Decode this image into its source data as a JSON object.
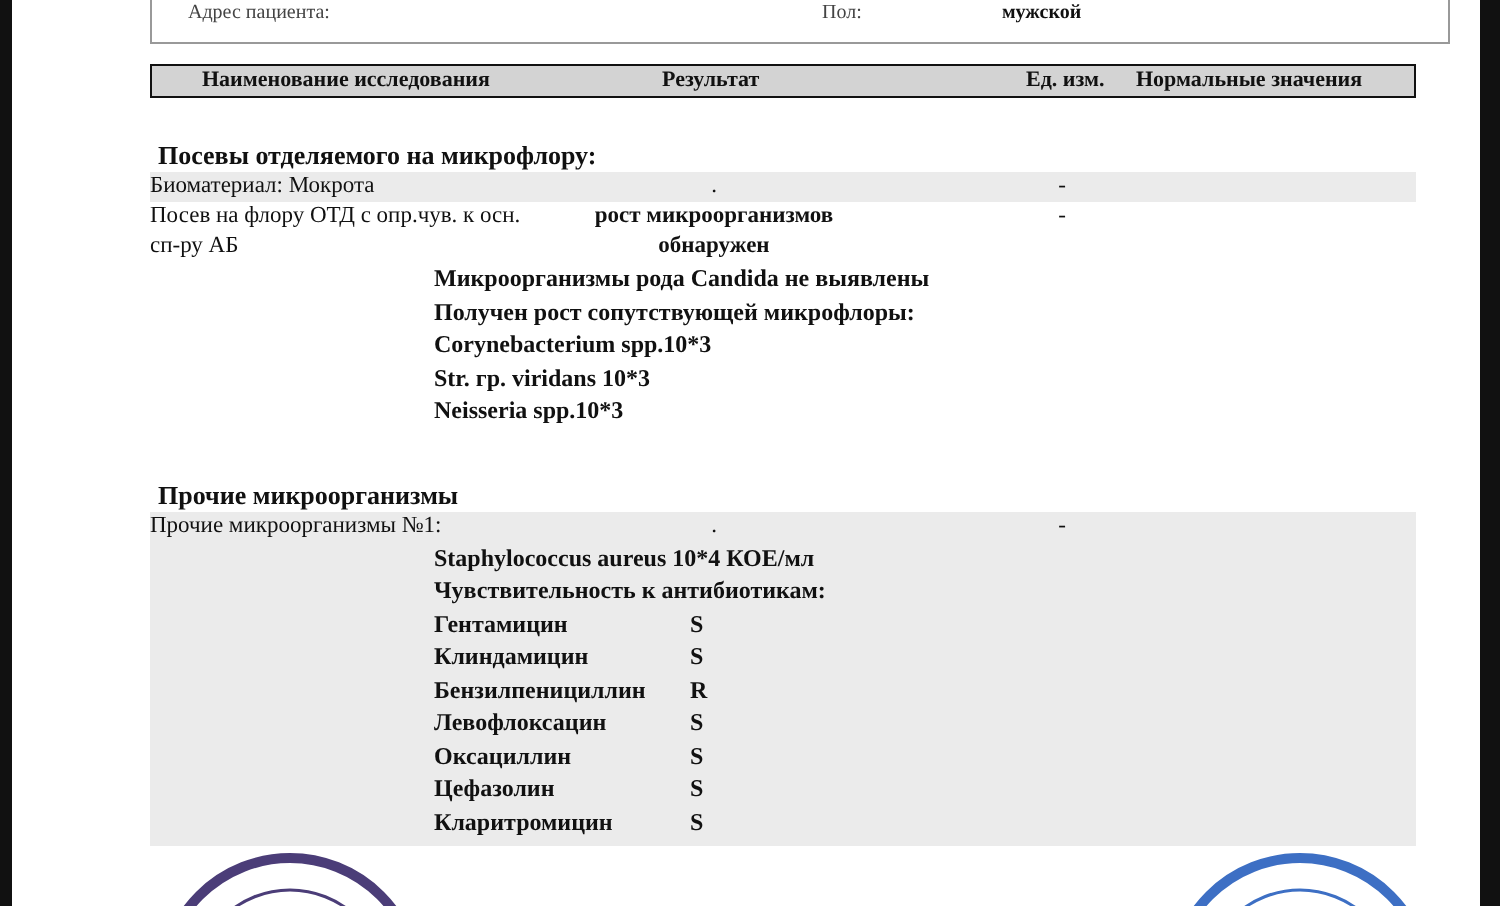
{
  "patient": {
    "address_label": "Адрес пациента:",
    "sex_label": "Пол:",
    "sex_value": "мужской"
  },
  "table_header": {
    "columns": [
      "Наименование исследования",
      "Результат",
      "Ед. изм.",
      "Нормальные значения"
    ]
  },
  "sections": [
    {
      "title": "Посевы отделяемого на микрофлору:",
      "rows": [
        {
          "name": "Биоматериал: Мокрота",
          "result": ".",
          "result_bold": false,
          "unit": "-",
          "shaded": true,
          "findings": [],
          "antibiotics": []
        },
        {
          "name": "Посев на флору ОТД с опр.чув. к осн. сп-ру АБ",
          "result": "рост микроорганизмов обнаружен",
          "result_bold": true,
          "unit": "-",
          "shaded": false,
          "findings": [
            "Микроорганизмы рода Candida не выявлены",
            "Получен рост сопутствующей микрофлоры:",
            "Corynebacterium spp.10*3",
            "Str. гр. viridans 10*3",
            "Neisseria spp.10*3"
          ],
          "antibiotics": []
        }
      ]
    },
    {
      "title": "Прочие микроорганизмы",
      "rows": [
        {
          "name": "Прочие микроорганизмы №1:",
          "result": ".",
          "result_bold": false,
          "unit": "-",
          "shaded": true,
          "findings": [
            "Staphylococcus aureus 10*4 КОЕ/мл",
            "Чувствительность к антибиотикам:"
          ],
          "antibiotics": [
            {
              "name": "Гентамицин",
              "value": "S"
            },
            {
              "name": "Клиндамицин",
              "value": "S"
            },
            {
              "name": "Бензилпенициллин",
              "value": "R"
            },
            {
              "name": "Левофлоксацин",
              "value": "S"
            },
            {
              "name": "Оксациллин",
              "value": "S"
            },
            {
              "name": "Цефазолин",
              "value": "S"
            },
            {
              "name": "Кларитромицин",
              "value": "S"
            }
          ]
        }
      ]
    }
  ]
}
